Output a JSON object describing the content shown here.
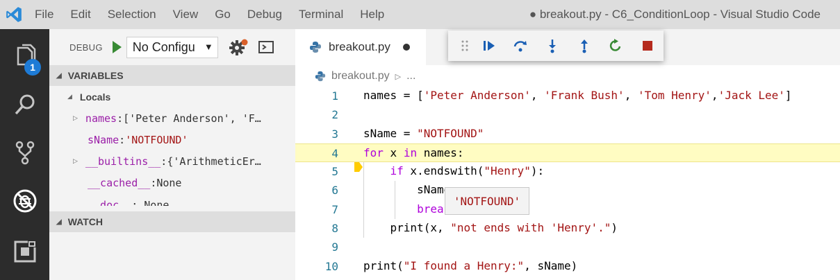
{
  "titlebar": {
    "menu": [
      "File",
      "Edit",
      "Selection",
      "View",
      "Go",
      "Debug",
      "Terminal",
      "Help"
    ],
    "window_title": "● breakout.py - C6_ConditionLoop - Visual Studio Code"
  },
  "activitybar": {
    "explorer_badge": "1",
    "items": [
      "explorer-icon",
      "search-icon",
      "source-control-icon",
      "debug-icon",
      "extensions-icon"
    ]
  },
  "debug": {
    "label": "DEBUG",
    "config_value": "No Configu",
    "dropdown_arrow": "▼"
  },
  "variables": {
    "header": "VARIABLES",
    "locals_label": "Locals",
    "rows": [
      {
        "name": "names",
        "sep": ": ",
        "value": "['Peter Anderson', 'F…",
        "expandable": true
      },
      {
        "name": "sName",
        "sep": ": ",
        "value": "'NOTFOUND'",
        "expandable": false
      },
      {
        "name": "__builtins__",
        "sep": ": ",
        "value": "{'ArithmeticEr…",
        "expandable": true
      },
      {
        "name": "__cached__",
        "sep": ": ",
        "value": "None",
        "expandable": false
      },
      {
        "name": "__doc__",
        "sep": ": ",
        "value": "None",
        "expandable": false
      }
    ]
  },
  "watch": {
    "header": "WATCH"
  },
  "editor": {
    "tab_title": "breakout.py",
    "breadcrumb_file": "breakout.py",
    "breadcrumb_more": "...",
    "hover_value": "'NOTFOUND'",
    "lines": [
      {
        "n": "1"
      },
      {
        "n": "2"
      },
      {
        "n": "3"
      },
      {
        "n": "4"
      },
      {
        "n": "5"
      },
      {
        "n": "6"
      },
      {
        "n": "7"
      },
      {
        "n": "8"
      },
      {
        "n": "9"
      },
      {
        "n": "10"
      }
    ]
  },
  "colors": {
    "breakpoint": "#e51400",
    "current_line_arrow": "#ffcc00",
    "accent_blue": "#1e7bd6",
    "stop_red": "#b52a1d",
    "restart_green": "#388a34"
  }
}
